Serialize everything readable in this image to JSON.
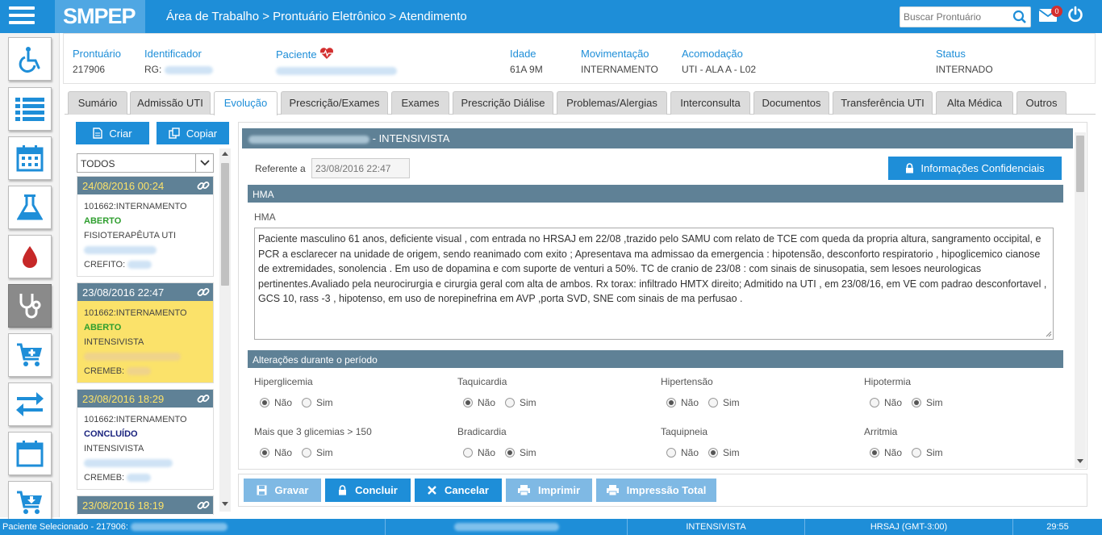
{
  "header": {
    "logo": "SMPEP",
    "breadcrumb": "Área de Trabalho > Prontuário Eletrônico > Atendimento",
    "search_placeholder": "Buscar Prontuário",
    "mail_badge": "0"
  },
  "left_nav": {
    "items": [
      "wheelchair-icon",
      "list-icon",
      "calendar-icon",
      "flask-icon",
      "blood-drop-icon",
      "stethoscope-icon",
      "cart-add-icon",
      "transfer-arrows-icon",
      "calendar-day-icon",
      "cart-download-icon"
    ]
  },
  "patient": {
    "prontuario_label": "Prontuário",
    "prontuario_value": "217906",
    "identificador_label": "Identificador",
    "identificador_value": "RG:",
    "paciente_label": "Paciente",
    "idade_label": "Idade",
    "idade_value": "61A 9M",
    "movimentacao_label": "Movimentação",
    "movimentacao_value": "INTERNAMENTO",
    "acomodacao_label": "Acomodação",
    "acomodacao_value": "UTI - ALA A - L02",
    "status_label": "Status",
    "status_value": "INTERNADO"
  },
  "tabs": [
    "Sumário",
    "Admissão UTI",
    "Evolução",
    "Prescrição/Exames",
    "Exames",
    "Prescrição Diálise",
    "Problemas/Alergias",
    "Interconsulta",
    "Documentos",
    "Transferência UTI",
    "Alta Médica",
    "Outros"
  ],
  "active_tab": "Evolução",
  "sidebar": {
    "criar": "Criar",
    "copiar": "Copiar",
    "filter": "TODOS",
    "cards": [
      {
        "date": "24/08/2016 00:24",
        "line1": "101662:INTERNAMENTO",
        "status": "ABERTO",
        "role": "FISIOTERAPÊUTA UTI",
        "reg": "CREFITO:"
      },
      {
        "date": "23/08/2016 22:47",
        "line1": "101662:INTERNAMENTO",
        "status": "ABERTO",
        "role": "INTENSIVISTA",
        "reg": "CREMEB:"
      },
      {
        "date": "23/08/2016 18:29",
        "line1": "101662:INTERNAMENTO",
        "status": "CONCLUÍDO",
        "role": "INTENSIVISTA",
        "reg": "CREMEB:"
      },
      {
        "date": "23/08/2016 18:19"
      }
    ]
  },
  "form": {
    "title": "- INTENSIVISTA",
    "referente_label": "Referente a",
    "referente_value": "23/08/2016 22:47",
    "confidencial_btn": "Informações Confidenciais",
    "hma_section": "HMA",
    "hma_label": "HMA",
    "hma_text": "Paciente masculino 61 anos,  deficiente visual , com  entrada no HRSAJ em 22/08 ,trazido pelo SAMU com relato de TCE com queda da propria altura, sangramento occipital, e PCR  a esclarecer na unidade de origem, sendo reanimado com exito ; Apresentava ma admissao  da emergencia :  hipotensão,  desconforto respiratorio ,  hipoglicemico  cianose de extremidades, sonolencia  . Em  uso de dopamina e com suporte de  venturi a 50%. TC de cranio de 23/08 : com sinais de sinusopatia, sem lesoes neurologicas pertinentes.Avaliado pela neurocirurgia  e cirurgia geral  com alta de ambos. Rx torax: infiltrado HMTX direito; Admitido na UTI , em 23/08/16, em  VE com padrao desconfortavel , GCS 10, rass -3 , hipotenso, em uso de norepinefrina em AVP ,porta SVD, SNE  com sinais de ma perfusao .",
    "alt_section": "Alterações durante o período",
    "nao": "Não",
    "sim": "Sim",
    "alteracoes": [
      {
        "label": "Hiperglicemia",
        "value": "Não"
      },
      {
        "label": "Taquicardia",
        "value": "Não"
      },
      {
        "label": "Hipertensão",
        "value": "Não"
      },
      {
        "label": "Hipotermia",
        "value": "Sim"
      },
      {
        "label": "Mais que 3 glicemias > 150",
        "value": "Não"
      },
      {
        "label": "Bradicardia",
        "value": "Sim"
      },
      {
        "label": "Taquipneia",
        "value": "Sim"
      },
      {
        "label": "Arritmia",
        "value": "Não"
      }
    ]
  },
  "actions": {
    "gravar": "Gravar",
    "concluir": "Concluir",
    "cancelar": "Cancelar",
    "imprimir": "Imprimir",
    "impressao_total": "Impressão Total"
  },
  "statusbar": {
    "selected": "Paciente Selecionado - 217906:",
    "role": "INTENSIVISTA",
    "unit": "HRSAJ (GMT-3:00)",
    "time": "29:55"
  },
  "colors": {
    "primary": "#1e8ed8",
    "section": "#5f8196",
    "selected_card": "#fbe26a",
    "open": "#2e9e2e",
    "done": "#1a237e",
    "danger": "#c62828"
  }
}
